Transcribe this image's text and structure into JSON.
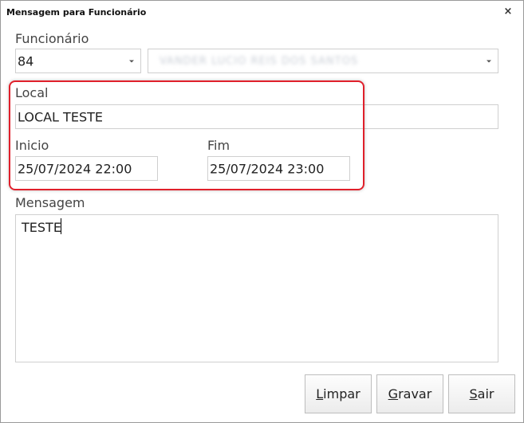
{
  "window": {
    "title": "Mensagem para Funcionário",
    "close_glyph": "×"
  },
  "funcionario": {
    "label": "Funcionário",
    "code": "84",
    "name_obscured": "VANDER LUCIO REIS DOS SANTOS"
  },
  "local": {
    "label": "Local",
    "value": "LOCAL TESTE"
  },
  "inicio": {
    "label": "Inicio",
    "value": "25/07/2024 22:00"
  },
  "fim": {
    "label": "Fim",
    "value": "25/07/2024 23:00"
  },
  "mensagem": {
    "label": "Mensagem",
    "value": "TESTE"
  },
  "buttons": {
    "limpar": {
      "mnemonic": "L",
      "rest": "impar"
    },
    "gravar": {
      "mnemonic": "G",
      "rest": "ravar"
    },
    "sair": {
      "mnemonic": "S",
      "rest": "air"
    }
  },
  "colors": {
    "highlight_border": "#e0202b",
    "field_border": "#cfcfcf",
    "label_text": "#444444"
  }
}
